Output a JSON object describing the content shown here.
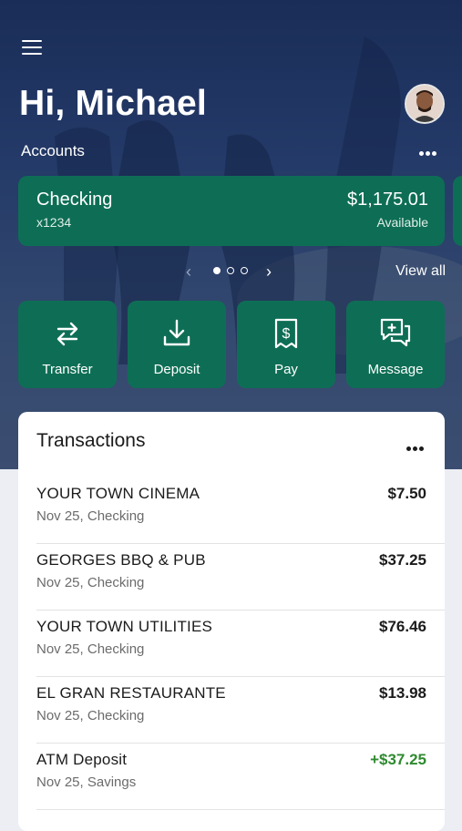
{
  "header": {
    "greeting": "Hi, Michael",
    "accounts_label": "Accounts",
    "view_all": "View all"
  },
  "accounts": [
    {
      "name": "Checking",
      "number": "x1234",
      "balance": "$1,175.01",
      "balance_label": "Available"
    }
  ],
  "pager": {
    "pages": 3,
    "current": 1
  },
  "actions": [
    {
      "label": "Transfer",
      "icon": "transfer-icon"
    },
    {
      "label": "Deposit",
      "icon": "deposit-icon"
    },
    {
      "label": "Pay",
      "icon": "pay-icon"
    },
    {
      "label": "Message",
      "icon": "message-icon"
    }
  ],
  "transactions": {
    "title": "Transactions",
    "items": [
      {
        "merchant": "YOUR TOWN CINEMA",
        "meta": "Nov 25, Checking",
        "amount": "$7.50",
        "credit": false
      },
      {
        "merchant": "GEORGES BBQ & PUB",
        "meta": "Nov 25, Checking",
        "amount": "$37.25",
        "credit": false
      },
      {
        "merchant": "YOUR TOWN UTILITIES",
        "meta": "Nov 25, Checking",
        "amount": "$76.46",
        "credit": false
      },
      {
        "merchant": "EL GRAN RESTAURANTE",
        "meta": "Nov 25, Checking",
        "amount": "$13.98",
        "credit": false
      },
      {
        "merchant": "ATM Deposit",
        "meta": "Nov 25, Savings",
        "amount": "+$37.25",
        "credit": true
      }
    ]
  },
  "colors": {
    "brand_green": "#0e6e55",
    "hero_navy": "#1a2d58",
    "credit_green": "#2f8a30"
  }
}
